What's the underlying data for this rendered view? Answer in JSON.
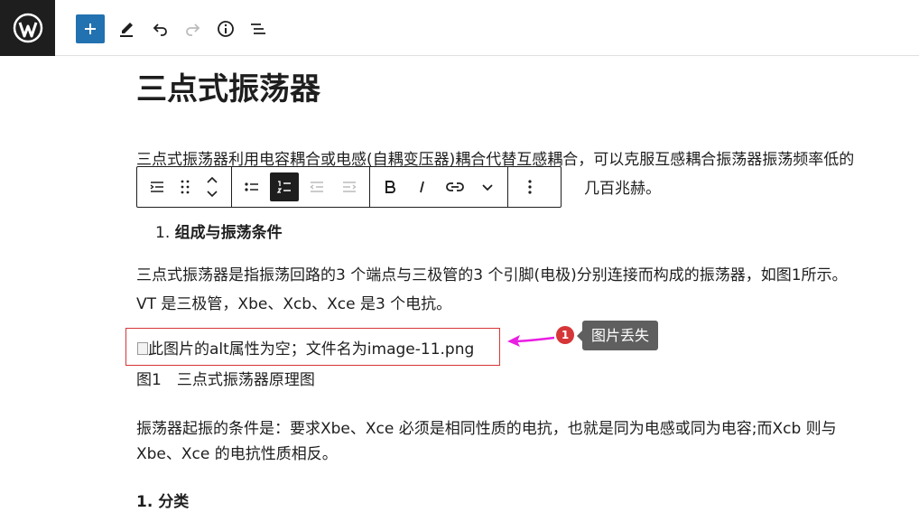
{
  "header": {
    "logo_icon": "wordpress-logo-icon",
    "add_icon": "plus-icon",
    "tools_icon": "pencil-icon",
    "undo_icon": "undo-icon",
    "redo_icon": "redo-icon",
    "info_icon": "info-icon",
    "outline_icon": "list-view-icon",
    "accent_color": "#2271b1"
  },
  "post": {
    "title": "三点式振荡器",
    "intro_line1": "三点式振荡器利用电容耦合或电感(自耦变压器)耦合代替互感耦合，可以克服互感耦合振荡器振荡频率低的",
    "intro_line2_tail": "几百兆赫。",
    "list_heading_number": "1.",
    "list_heading": "组成与振荡条件",
    "body_line1": "三点式振荡器是指振荡回路的3 个端点与三极管的3 个引脚(电极)分别连接而构成的振荡器，如图1所示。",
    "body_line2": "VT 是三极管，Xbe、Xcb、Xce 是3 个电抗。",
    "image_alt": "此图片的alt属性为空；文件名为image-11.png",
    "figure_caption": "图1　三点式振荡器原理图",
    "cond_line1": "振荡器起振的条件是：要求Xbe、Xce 必须是相同性质的电抗，也就是同为电感或同为电容;而Xcb 则与",
    "cond_line2": "Xbe、Xce 的电抗性质相反。",
    "section2": "1. 分类"
  },
  "annotation": {
    "badge_number": "1",
    "tooltip": "图片丢失",
    "badge_color": "#d63638",
    "arrow_color": "#e91ee3"
  },
  "block_toolbar": {
    "icons": [
      "outdent-list-icon",
      "drag-handle-icon",
      "move-updown-icon",
      "bullet-list-icon",
      "numbered-list-icon",
      "outdent-icon",
      "indent-icon",
      "bold-icon",
      "italic-icon",
      "link-icon",
      "chevron-down-icon",
      "more-options-icon"
    ]
  }
}
